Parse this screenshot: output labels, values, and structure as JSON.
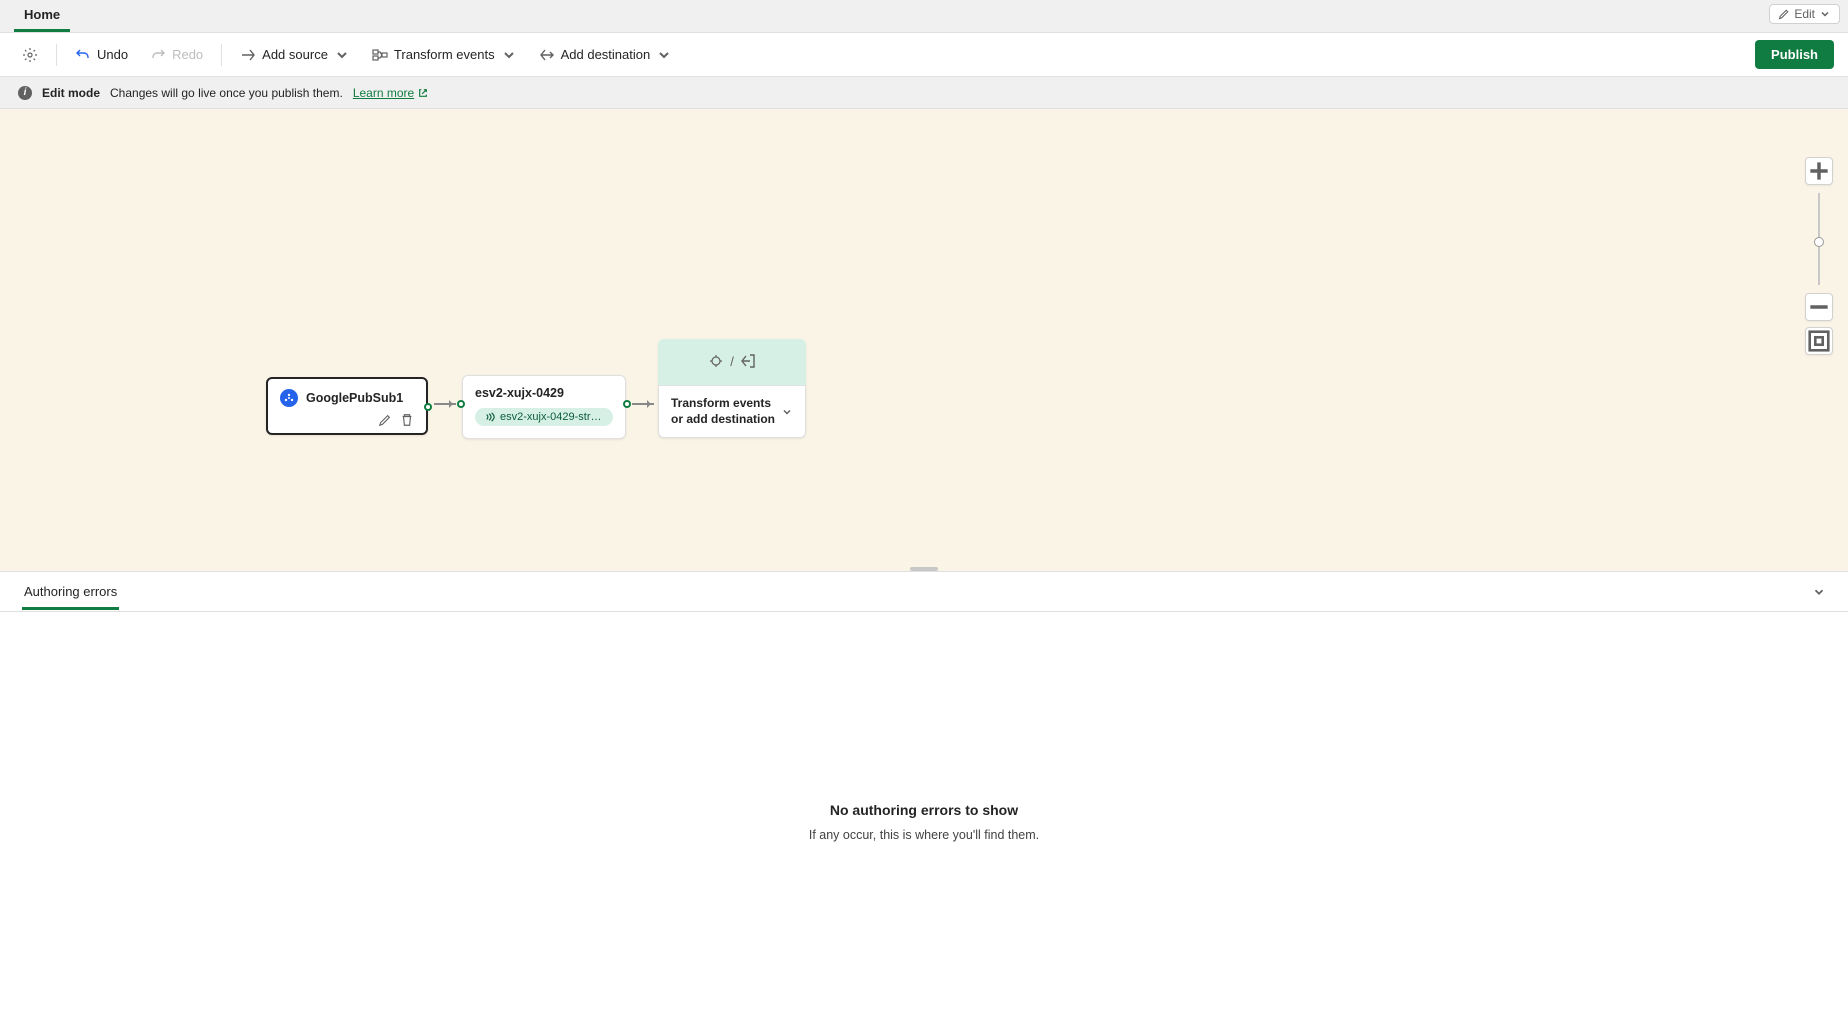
{
  "tabs": {
    "home": "Home"
  },
  "edit_pill": {
    "label": "Edit"
  },
  "toolbar": {
    "undo": "Undo",
    "redo": "Redo",
    "add_source": "Add source",
    "transform_events": "Transform events",
    "add_destination": "Add destination",
    "publish": "Publish"
  },
  "banner": {
    "mode": "Edit mode",
    "msg": "Changes will go live once you publish them.",
    "learn_more": "Learn more"
  },
  "nodes": {
    "source": {
      "title": "GooglePubSub1"
    },
    "stream": {
      "title": "esv2-xujx-0429",
      "chip": "esv2-xujx-0429-str…"
    },
    "add": {
      "label": "Transform events or add destination"
    }
  },
  "bottom": {
    "tab": "Authoring errors",
    "empty_title": "No authoring errors to show",
    "empty_sub": "If any occur, this is where you'll find them."
  }
}
